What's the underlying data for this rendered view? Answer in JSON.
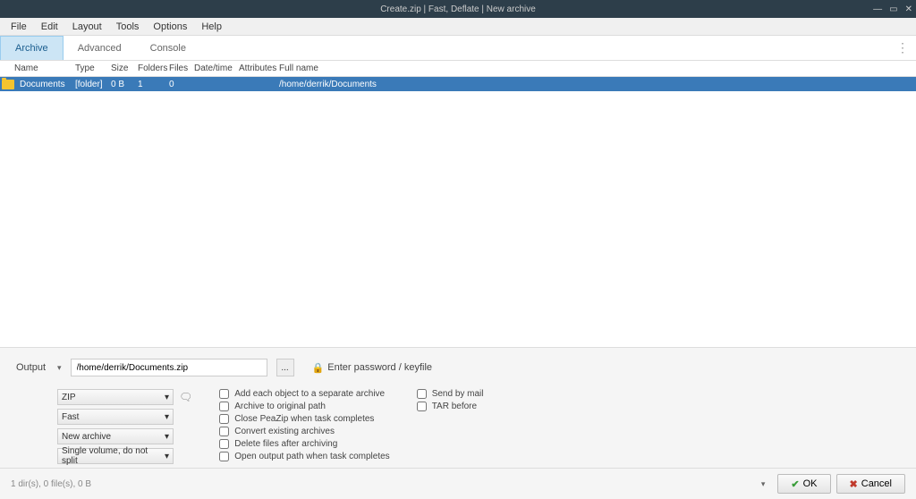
{
  "titlebar": {
    "title": "Create.zip | Fast, Deflate | New archive"
  },
  "menubar": {
    "items": [
      "File",
      "Edit",
      "Layout",
      "Tools",
      "Options",
      "Help"
    ]
  },
  "tabs": {
    "items": [
      "Archive",
      "Advanced",
      "Console"
    ],
    "active_index": 0
  },
  "columns": {
    "name": "Name",
    "type": "Type",
    "size": "Size",
    "folders": "Folders",
    "files": "Files",
    "datetime": "Date/time",
    "attributes": "Attributes",
    "fullname": "Full name"
  },
  "rows": [
    {
      "name": "Documents",
      "type": "[folder]",
      "size": "0 B",
      "folders": "1",
      "files": "0",
      "datetime": "",
      "attributes": "",
      "fullname": "/home/derrik/Documents",
      "selected": true
    }
  ],
  "output": {
    "label": "Output",
    "path": "/home/derrik/Documents.zip",
    "browse": "...",
    "password_label": "Enter password / keyfile"
  },
  "dropdowns": {
    "format": "ZIP",
    "level": "Fast",
    "action": "New archive",
    "split": "Single volume, do not split"
  },
  "checkboxes": {
    "separate": "Add each object to a separate archive",
    "original_path": "Archive to original path",
    "close_peazip": "Close PeaZip when task completes",
    "convert": "Convert existing archives",
    "delete_after": "Delete files after archiving",
    "open_output": "Open output path when task completes",
    "send_mail": "Send by mail",
    "tar_before": "TAR before"
  },
  "footer": {
    "status": "1 dir(s), 0 file(s), 0 B",
    "ok": "OK",
    "cancel": "Cancel"
  }
}
